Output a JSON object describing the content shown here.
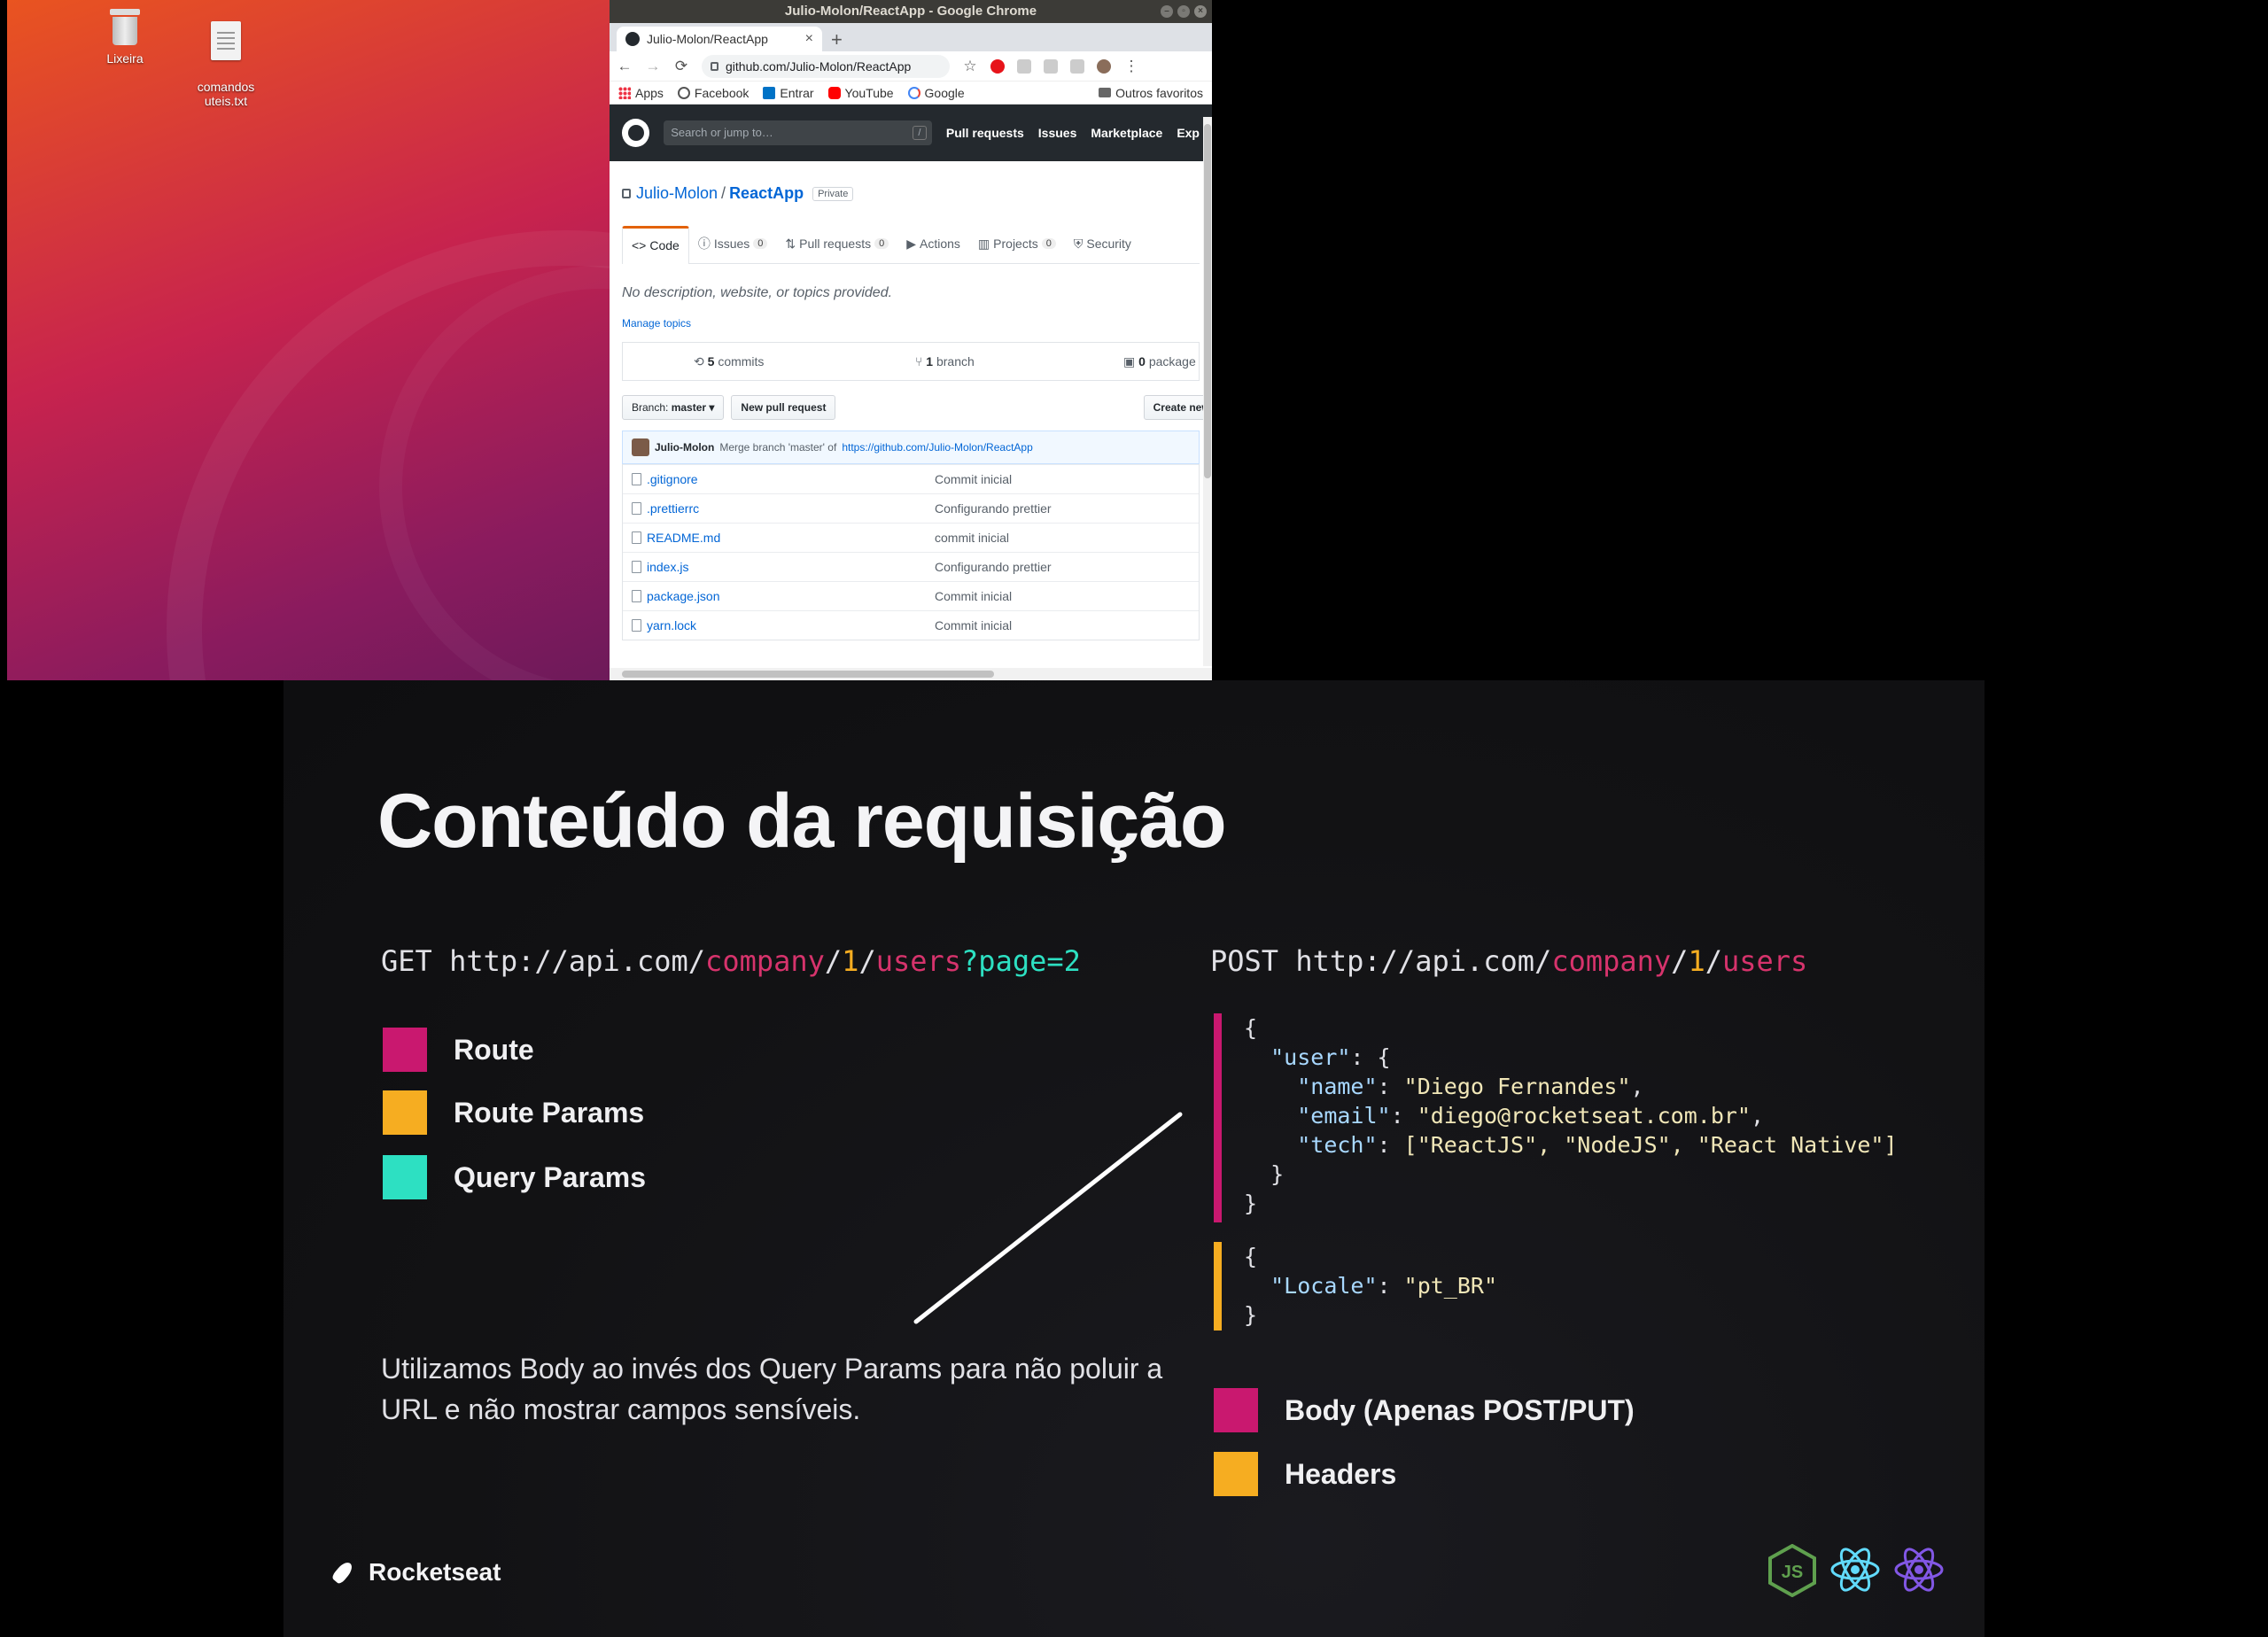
{
  "desktop": {
    "icons": [
      {
        "label": "Lixeira"
      },
      {
        "label": "comandos\nuteis.txt"
      }
    ]
  },
  "chrome": {
    "window_title": "Julio-Molon/ReactApp - Google Chrome",
    "tab_title": "Julio-Molon/ReactApp",
    "tab_close": "×",
    "new_tab": "+",
    "url": "github.com/Julio-Molon/ReactApp",
    "nav": {
      "back": "←",
      "forward": "→",
      "reload": "⟳",
      "menu": "⋮",
      "star": "☆"
    },
    "bookmarks": [
      "Apps",
      "Facebook",
      "Entrar",
      "YouTube",
      "Google"
    ],
    "other_bookmarks": "Outros favoritos"
  },
  "github": {
    "search_placeholder": "Search or jump to…",
    "search_key": "/",
    "header_nav": [
      "Pull requests",
      "Issues",
      "Marketplace",
      "Exp"
    ],
    "owner": "Julio-Molon",
    "separator": "/",
    "repo": "ReactApp",
    "visibility": "Private",
    "tabs": [
      {
        "icon": "<>",
        "label": "Code",
        "count": ""
      },
      {
        "icon": "ⓘ",
        "label": "Issues",
        "count": "0"
      },
      {
        "icon": "⇅",
        "label": "Pull requests",
        "count": "0"
      },
      {
        "icon": "▶",
        "label": "Actions",
        "count": ""
      },
      {
        "icon": "▥",
        "label": "Projects",
        "count": "0"
      },
      {
        "icon": "⛨",
        "label": "Security",
        "count": ""
      }
    ],
    "description": "No description, website, or topics provided.",
    "manage_topics": "Manage topics",
    "stats": {
      "commits_num": "5",
      "commits_label": "commits",
      "branch_num": "1",
      "branch_label": "branch",
      "packages_num": "0",
      "packages_label": "package"
    },
    "branch_label": "Branch:",
    "branch_value": "master ▾",
    "new_pull_request": "New pull request",
    "create_new": "Create new f",
    "latest_commit": {
      "author": "Julio-Molon",
      "message": "Merge branch 'master' of",
      "link": "https://github.com/Julio-Molon/ReactApp"
    },
    "files": [
      {
        "name": ".gitignore",
        "message": "Commit inicial"
      },
      {
        "name": ".prettierrc",
        "message": "Configurando prettier"
      },
      {
        "name": "README.md",
        "message": "commit inicial"
      },
      {
        "name": "index.js",
        "message": "Configurando prettier"
      },
      {
        "name": "package.json",
        "message": "Commit inicial"
      },
      {
        "name": "yarn.lock",
        "message": "Commit inicial"
      }
    ]
  },
  "slide": {
    "title": "Conteúdo da requisição",
    "get_url": {
      "method": "GET ",
      "base": "http://api.com/",
      "route": "company",
      "sep1": "/",
      "param": "1",
      "sep2": "/",
      "route2": "users",
      "query": "?page=2"
    },
    "legend_left": [
      {
        "label": "Route",
        "color": "#c9186f"
      },
      {
        "label": "Route Params",
        "color": "#f6ad21"
      },
      {
        "label": "Query Params",
        "color": "#2de0c2"
      }
    ],
    "note": "Utilizamos Body ao invés dos Query Params para não poluir a URL e não mostrar campos sensíveis.",
    "post_url": {
      "method": "POST ",
      "base": "http://api.com/",
      "route": "company",
      "sep1": "/",
      "param": "1",
      "sep2": "/",
      "route2": "users"
    },
    "body_code": {
      "open": "{",
      "user_key": "\"user\"",
      "user_open": ": {",
      "name_key": "\"name\"",
      "name_val": "\"Diego Fernandes\"",
      "email_key": "\"email\"",
      "email_val": "\"diego@rocketseat.com.br\"",
      "tech_key": "\"tech\"",
      "tech_val": "[\"ReactJS\", \"NodeJS\", \"React Native\"]",
      "inner_close": "}",
      "close": "}"
    },
    "headers_code": {
      "open": "{",
      "locale_key": "\"Locale\"",
      "locale_val": "\"pt_BR\"",
      "close": "}"
    },
    "legend_right": [
      {
        "label": "Body (Apenas POST/PUT)",
        "color": "#c9186f"
      },
      {
        "label": "Headers",
        "color": "#f6ad21"
      }
    ],
    "brand": "Rocketseat",
    "tech_icon_names": [
      "nodejs-icon",
      "react-icon",
      "react-native-icon"
    ]
  }
}
